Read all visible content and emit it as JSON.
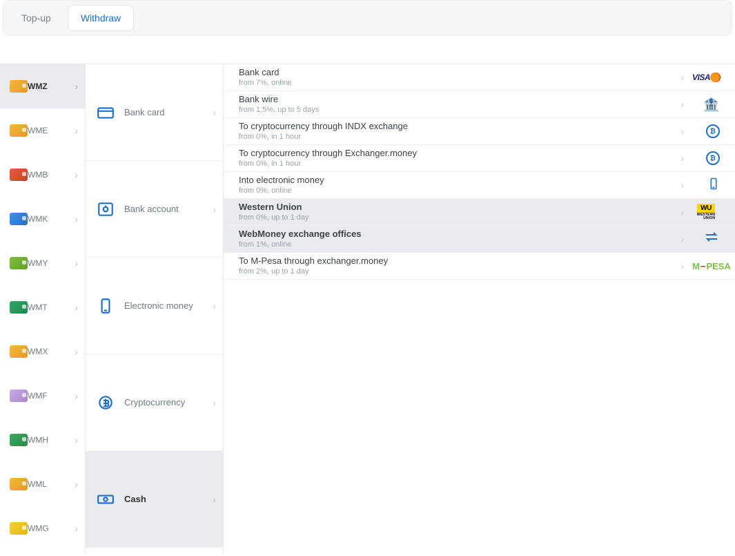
{
  "tabs": {
    "topup": "Top-up",
    "withdraw": "Withdraw",
    "active": "withdraw"
  },
  "currencies": [
    {
      "code": "WMZ",
      "color1": "#f4b83f",
      "color2": "#e69a1e",
      "active": true
    },
    {
      "code": "WME",
      "color1": "#f4b83f",
      "color2": "#e69a1e",
      "active": false
    },
    {
      "code": "WMB",
      "color1": "#e85c3f",
      "color2": "#c7432a",
      "active": false
    },
    {
      "code": "WMK",
      "color1": "#3f8fe8",
      "color2": "#2b6fc2",
      "active": false
    },
    {
      "code": "WMY",
      "color1": "#7fbf3f",
      "color2": "#5fa028",
      "active": false
    },
    {
      "code": "WMT",
      "color1": "#2fa866",
      "color2": "#1f8a4e",
      "active": false
    },
    {
      "code": "WMX",
      "color1": "#f4b83f",
      "color2": "#e69a1e",
      "active": false
    },
    {
      "code": "WMF",
      "color1": "#c9a9e6",
      "color2": "#a987cf",
      "active": false
    },
    {
      "code": "WMH",
      "color1": "#3fa85f",
      "color2": "#2b8a46",
      "active": false
    },
    {
      "code": "WML",
      "color1": "#f4b83f",
      "color2": "#e69a1e",
      "active": false
    },
    {
      "code": "WMG",
      "color1": "#f4d03f",
      "color2": "#e6b800",
      "active": false
    }
  ],
  "categories": [
    {
      "key": "bankcard",
      "label": "Bank card",
      "icon": "card",
      "active": false
    },
    {
      "key": "bankacct",
      "label": "Bank account",
      "icon": "safe",
      "active": false
    },
    {
      "key": "emoney",
      "label": "Electronic money",
      "icon": "phone",
      "active": false
    },
    {
      "key": "crypto",
      "label": "Cryptocurrency",
      "icon": "crypto",
      "active": false
    },
    {
      "key": "cash",
      "label": "Cash",
      "icon": "cash",
      "active": true
    }
  ],
  "methods": [
    {
      "title": "Bank card",
      "sub": "from 7%, online",
      "icon": "visa-mc",
      "highlight": false
    },
    {
      "title": "Bank wire",
      "sub": "from 1,5%, up to 5 days",
      "icon": "bank",
      "highlight": false
    },
    {
      "title": "To cryptocurrency through INDX exchange",
      "sub": "from 0%, in 1 hour",
      "icon": "crypto",
      "highlight": false
    },
    {
      "title": "To cryptocurrency through Exchanger.money",
      "sub": "from 0%, in 1 hour",
      "icon": "crypto",
      "highlight": false
    },
    {
      "title": "Into electronic money",
      "sub": "from 0%, online",
      "icon": "phone",
      "highlight": false
    },
    {
      "title": "Western Union",
      "sub": "from 0%, up to 1 day",
      "icon": "wu",
      "highlight": true
    },
    {
      "title": "WebMoney exchange offices",
      "sub": "from 1%, online",
      "icon": "swap",
      "highlight": true
    },
    {
      "title": "To M-Pesa through exchanger.money",
      "sub": "from 2%, up to 1 day",
      "icon": "mpesa",
      "highlight": false
    }
  ]
}
